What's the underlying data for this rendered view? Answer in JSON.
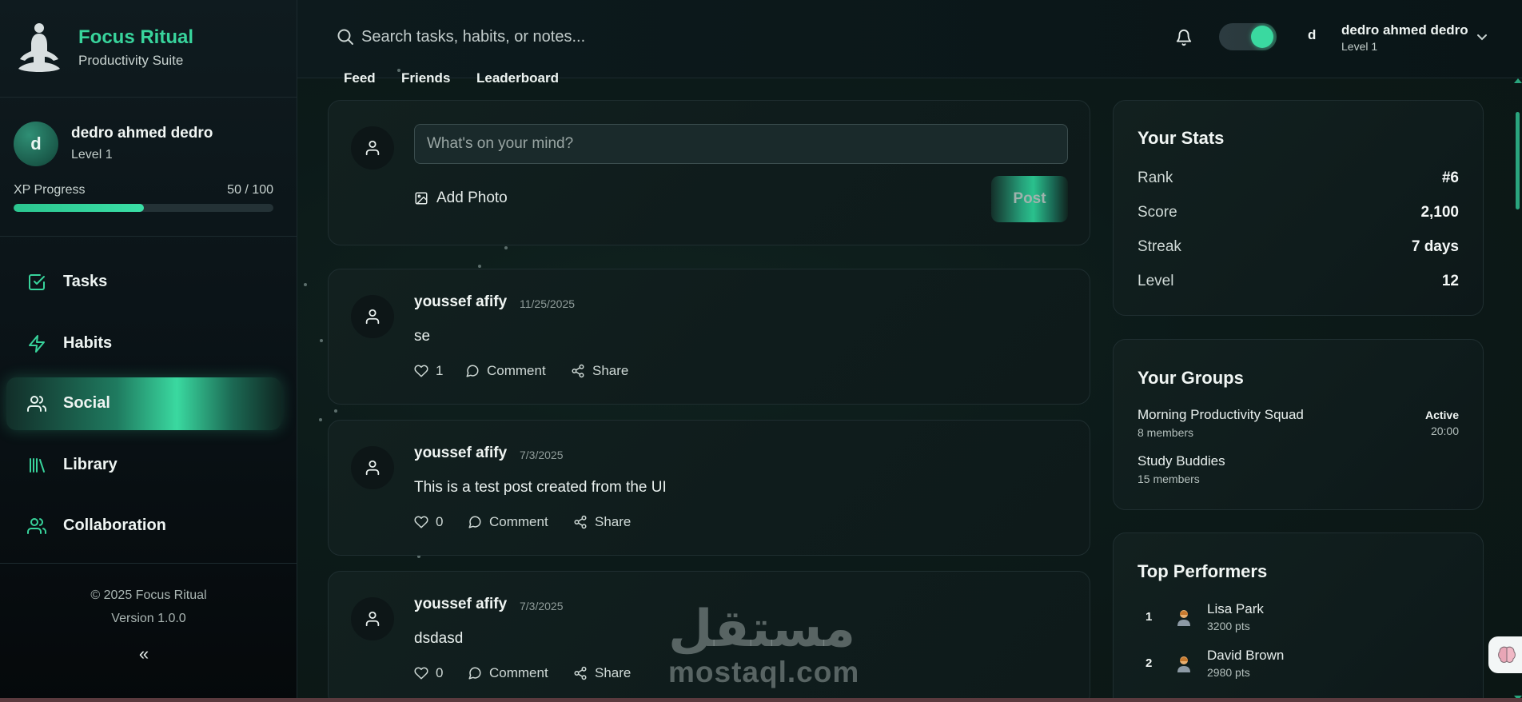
{
  "app": {
    "title": "Focus Ritual",
    "subtitle": "Productivity Suite"
  },
  "user": {
    "initial": "d",
    "name": "dedro ahmed dedro",
    "level": "Level 1",
    "xp_label": "XP Progress",
    "xp_text": "50 / 100",
    "xp_fraction": 0.5
  },
  "nav": {
    "items": [
      {
        "label": "Tasks",
        "icon": "check-square-icon"
      },
      {
        "label": "Habits",
        "icon": "lightning-icon"
      },
      {
        "label": "Social",
        "icon": "users-icon",
        "active": true
      },
      {
        "label": "Library",
        "icon": "library-icon"
      },
      {
        "label": "Collaboration",
        "icon": "users-icon"
      }
    ]
  },
  "footer": {
    "copyright": "© 2025 Focus Ritual",
    "version": "Version 1.0.0",
    "collapse": "«"
  },
  "topbar": {
    "search_placeholder": "Search tasks, habits, or notes...",
    "theme_toggle_on": true
  },
  "tabs": [
    {
      "label": "Feed",
      "active": true
    },
    {
      "label": "Friends"
    },
    {
      "label": "Leaderboard"
    }
  ],
  "compose": {
    "placeholder": "What's on your mind?",
    "add_photo": "Add Photo",
    "post_button": "Post"
  },
  "posts": [
    {
      "author": "youssef afify",
      "date": "11/25/2025",
      "text": "se",
      "likes": "1",
      "comment": "Comment",
      "share": "Share"
    },
    {
      "author": "youssef afify",
      "date": "7/3/2025",
      "text": "This is a test post created from the UI",
      "likes": "0",
      "comment": "Comment",
      "share": "Share"
    },
    {
      "author": "youssef afify",
      "date": "7/3/2025",
      "text": "dsdasd",
      "likes": "0",
      "comment": "Comment",
      "share": "Share"
    }
  ],
  "stats": {
    "title": "Your Stats",
    "rows": [
      {
        "label": "Rank",
        "value": "#6"
      },
      {
        "label": "Score",
        "value": "2,100"
      },
      {
        "label": "Streak",
        "value": "7 days"
      },
      {
        "label": "Level",
        "value": "12"
      }
    ]
  },
  "groups": {
    "title": "Your Groups",
    "items": [
      {
        "name": "Morning Productivity Squad",
        "members": "8 members",
        "status": "Active",
        "time": "20:00"
      },
      {
        "name": "Study Buddies",
        "members": "15 members"
      }
    ]
  },
  "performers": {
    "title": "Top Performers",
    "items": [
      {
        "rank": "1",
        "name": "Lisa Park",
        "points": "3200 pts"
      },
      {
        "rank": "2",
        "name": "David Brown",
        "points": "2980 pts"
      }
    ]
  },
  "watermark": {
    "arabic": "مستقل",
    "latin": "mostaql.com"
  },
  "colors": {
    "accent": "#38d49c",
    "background": "#0b1614",
    "card": "#12201f"
  }
}
